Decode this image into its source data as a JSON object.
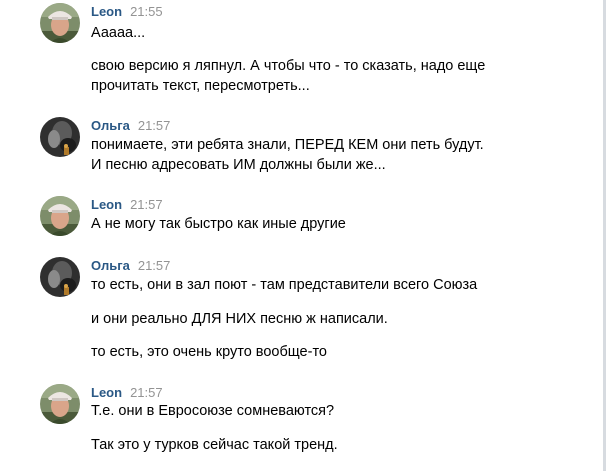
{
  "colors": {
    "author": "#2a5885",
    "time": "#939393",
    "text": "#000000",
    "background": "#ffffff"
  },
  "messages": [
    {
      "author": "Leon",
      "time": "21:55",
      "avatar": "leon-avatar",
      "lines": [
        "Ааааа...",
        "свою версию я ляпнул. А чтобы что - то сказать, надо еще",
        "прочитать текст, пересмотреть..."
      ]
    },
    {
      "author": "Ольга",
      "time": "21:57",
      "avatar": "olga-avatar",
      "lines": [
        "понимаете, эти ребята знали, ПЕРЕД КЕМ они петь будут.",
        "И песню адресовать ИМ должны были же..."
      ]
    },
    {
      "author": "Leon",
      "time": "21:57",
      "avatar": "leon-avatar",
      "lines": [
        "А не могу так быстро как иные другие"
      ]
    },
    {
      "author": "Ольга",
      "time": "21:57",
      "avatar": "olga-avatar",
      "lines": [
        "то есть, они в зал поют - там представители всего Союза",
        "и они реально ДЛЯ НИХ песню ж написали.",
        "то есть, это очень круто вообще-то"
      ]
    },
    {
      "author": "Leon",
      "time": "21:57",
      "avatar": "leon-avatar",
      "lines": [
        "Т.е. они в Евросоюзе сомневаются?",
        "Так это у турков сейчас такой тренд."
      ]
    }
  ]
}
